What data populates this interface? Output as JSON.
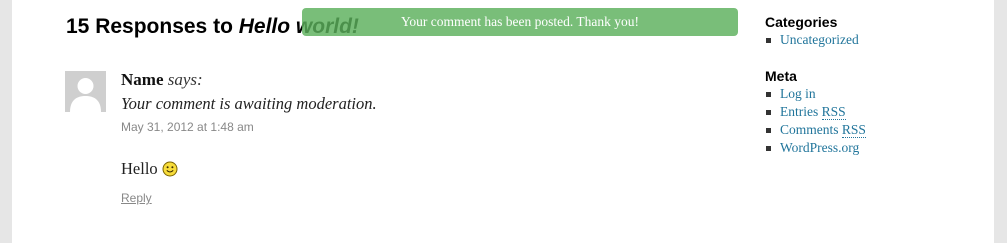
{
  "notice": {
    "text": "Your comment has been posted. Thank you!"
  },
  "comments_heading": {
    "count_text": "15 Responses to ",
    "post_title": "Hello world!"
  },
  "comment": {
    "author": "Name",
    "says": "says:",
    "moderation_text": "Your comment is awaiting moderation.",
    "date": "May 31, 2012 at 1:48 am",
    "body": "Hello",
    "reply_label": "Reply",
    "smiley_icon": "smiley-emoticon"
  },
  "sidebar": {
    "categories": {
      "title": "Categories",
      "items": [
        "Uncategorized"
      ]
    },
    "meta": {
      "title": "Meta",
      "items": [
        {
          "text": "Log in"
        },
        {
          "text": "Entries ",
          "abbr": "RSS"
        },
        {
          "text": "Comments ",
          "abbr": "RSS"
        },
        {
          "text": "WordPress.org"
        }
      ]
    }
  },
  "colors": {
    "link": "#21759b",
    "notice_bg": "#5cb05c",
    "page_bg": "#e6e6e6"
  }
}
